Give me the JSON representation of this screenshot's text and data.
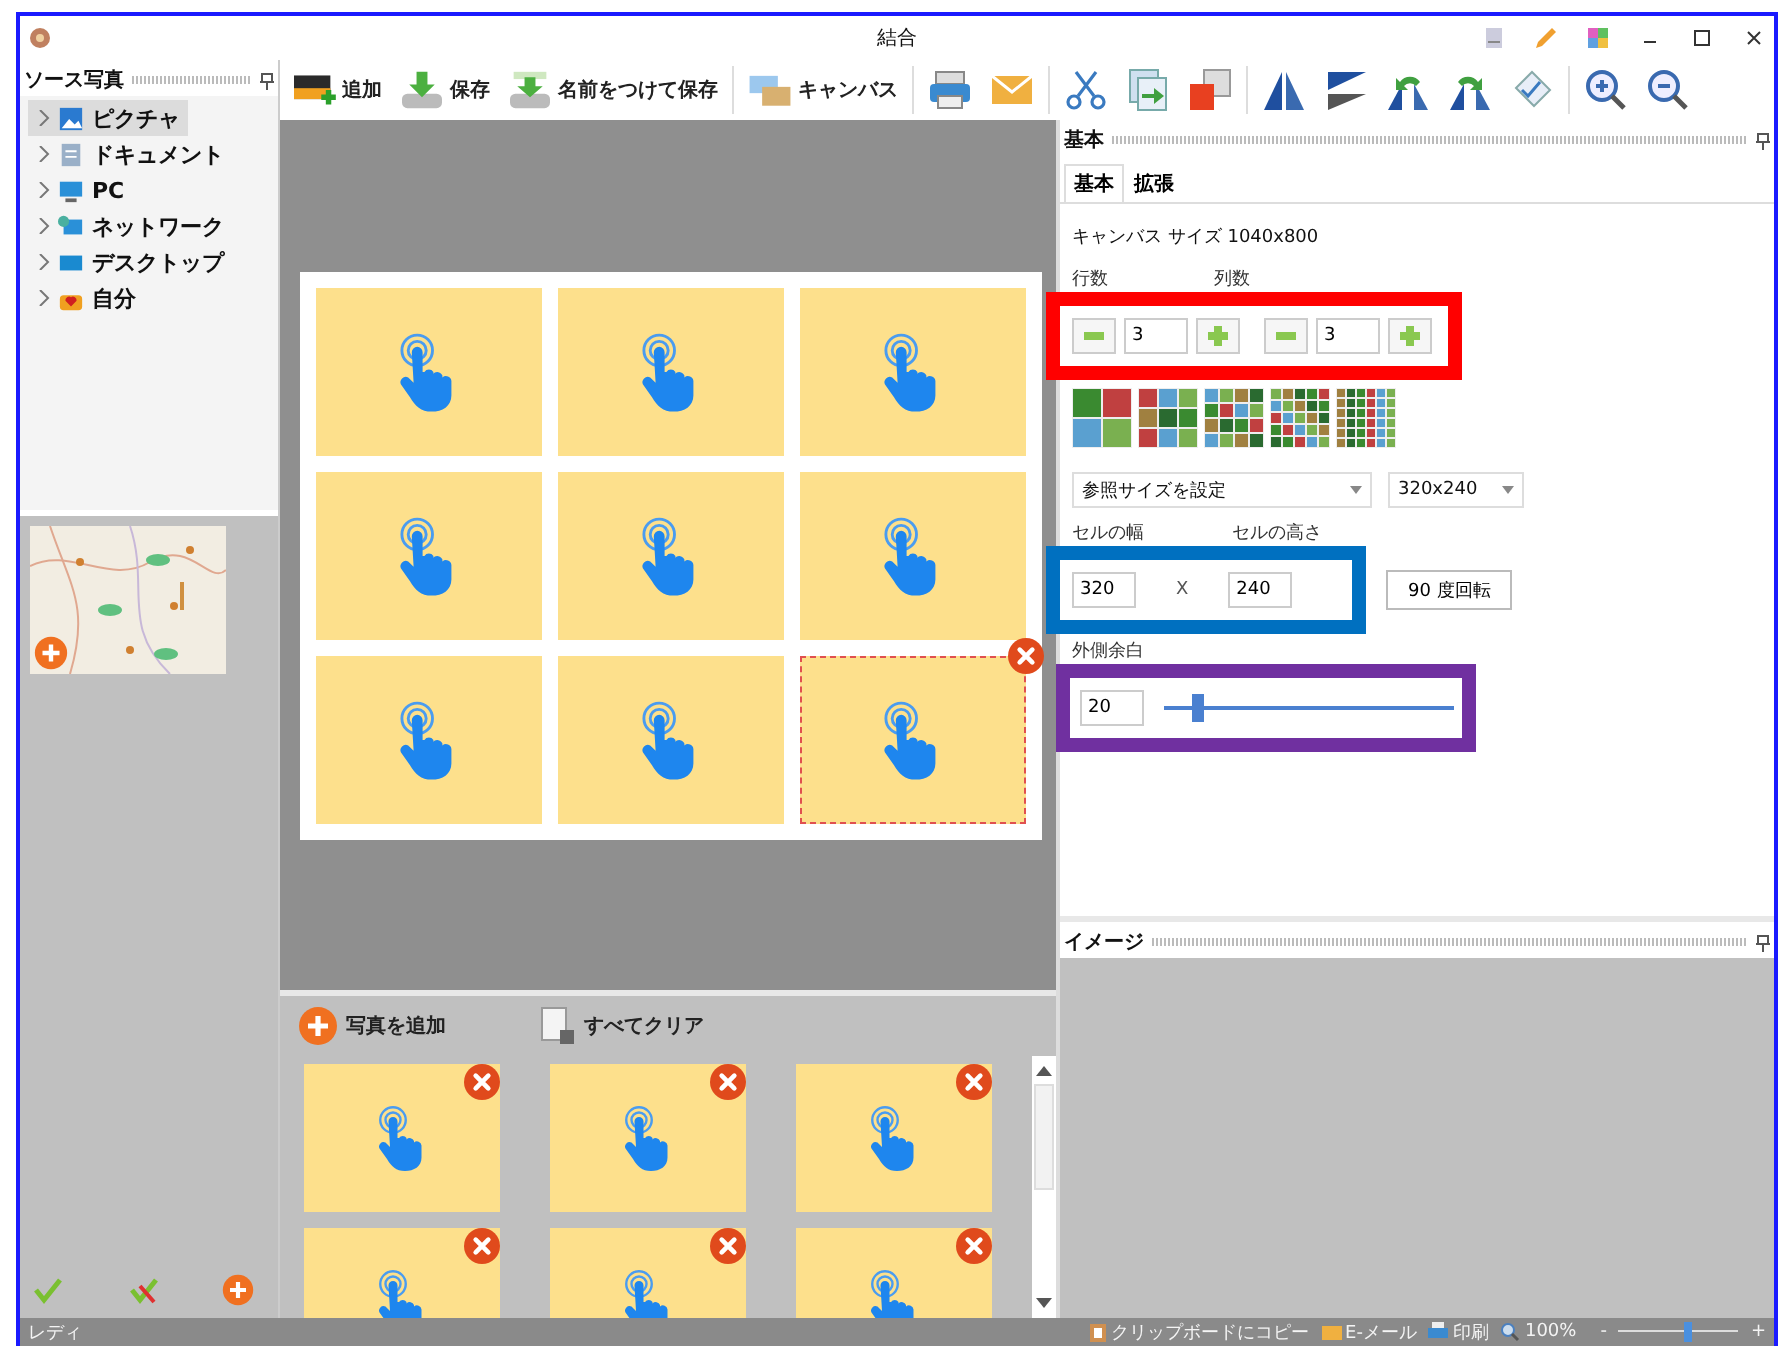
{
  "window": {
    "title": "結合"
  },
  "source_panel": {
    "title": "ソース写真",
    "tree": [
      {
        "label": "ピクチャ",
        "selected": true,
        "expanded": false
      },
      {
        "label": "ドキュメント",
        "selected": false,
        "expanded": false
      },
      {
        "label": "PC",
        "selected": false,
        "expanded": false
      },
      {
        "label": "ネットワーク",
        "selected": false,
        "expanded": false
      },
      {
        "label": "デスクトップ",
        "selected": false,
        "expanded": false
      },
      {
        "label": "自分",
        "selected": false,
        "expanded": false
      }
    ]
  },
  "toolbar": {
    "buttons": [
      {
        "label": "追加"
      },
      {
        "label": "保存"
      },
      {
        "label": "名前をつけて保存"
      },
      {
        "label": "キャンバス"
      }
    ]
  },
  "canvas": {
    "cells": [
      {
        "kind": "tap-image",
        "selected": false
      },
      {
        "kind": "tap-image",
        "selected": false
      },
      {
        "kind": "tap-image",
        "selected": false
      },
      {
        "kind": "tap-image",
        "selected": false
      },
      {
        "kind": "tap-image",
        "selected": false
      },
      {
        "kind": "tap-image",
        "selected": false
      },
      {
        "kind": "tap-image",
        "selected": false
      },
      {
        "kind": "tap-image",
        "selected": false
      },
      {
        "kind": "tap-image",
        "selected": true
      }
    ]
  },
  "photo_tray": {
    "buttons": [
      {
        "label": "写真を追加"
      },
      {
        "label": "すべてクリア"
      }
    ],
    "thumbnails": [
      {
        "kind": "tap-image"
      },
      {
        "kind": "tap-image"
      },
      {
        "kind": "tap-image"
      },
      {
        "kind": "tap-image"
      },
      {
        "kind": "tap-image"
      },
      {
        "kind": "tap-image"
      }
    ]
  },
  "basic_panel": {
    "title": "基本",
    "tabs": [
      {
        "label": "基本",
        "selected": true
      },
      {
        "label": "拡張",
        "selected": false
      }
    ],
    "canvas_size": "キャンバス サイズ 1040x800",
    "rows": {
      "label": "行数",
      "value": "3"
    },
    "columns": {
      "label": "列数",
      "value": "3"
    },
    "size_preset": "参照サイズを設定",
    "size_choice": "320x240",
    "cell_width": {
      "label": "セルの幅",
      "value": "320"
    },
    "times": "X",
    "cell_height": {
      "label": "セルの高さ",
      "value": "240"
    },
    "rotate_button": "90 度回転",
    "outer_margin": {
      "label": "外側余白",
      "value": "20",
      "level": 0.12
    }
  },
  "image_panel": {
    "title": "イメージ"
  },
  "status_bar": {
    "text": "レディ",
    "items": [
      {
        "label": "クリップボードにコピー"
      },
      {
        "label": "E-メール"
      },
      {
        "label": "印刷"
      },
      {
        "label": "100%"
      }
    ],
    "zoom_out": "-",
    "zoom_in": "+",
    "zoom": {
      "level": 0.6
    }
  },
  "annotations": [
    {
      "color": "#ff0000"
    },
    {
      "color": "#0070c0"
    },
    {
      "color": "#7030a0"
    }
  ]
}
